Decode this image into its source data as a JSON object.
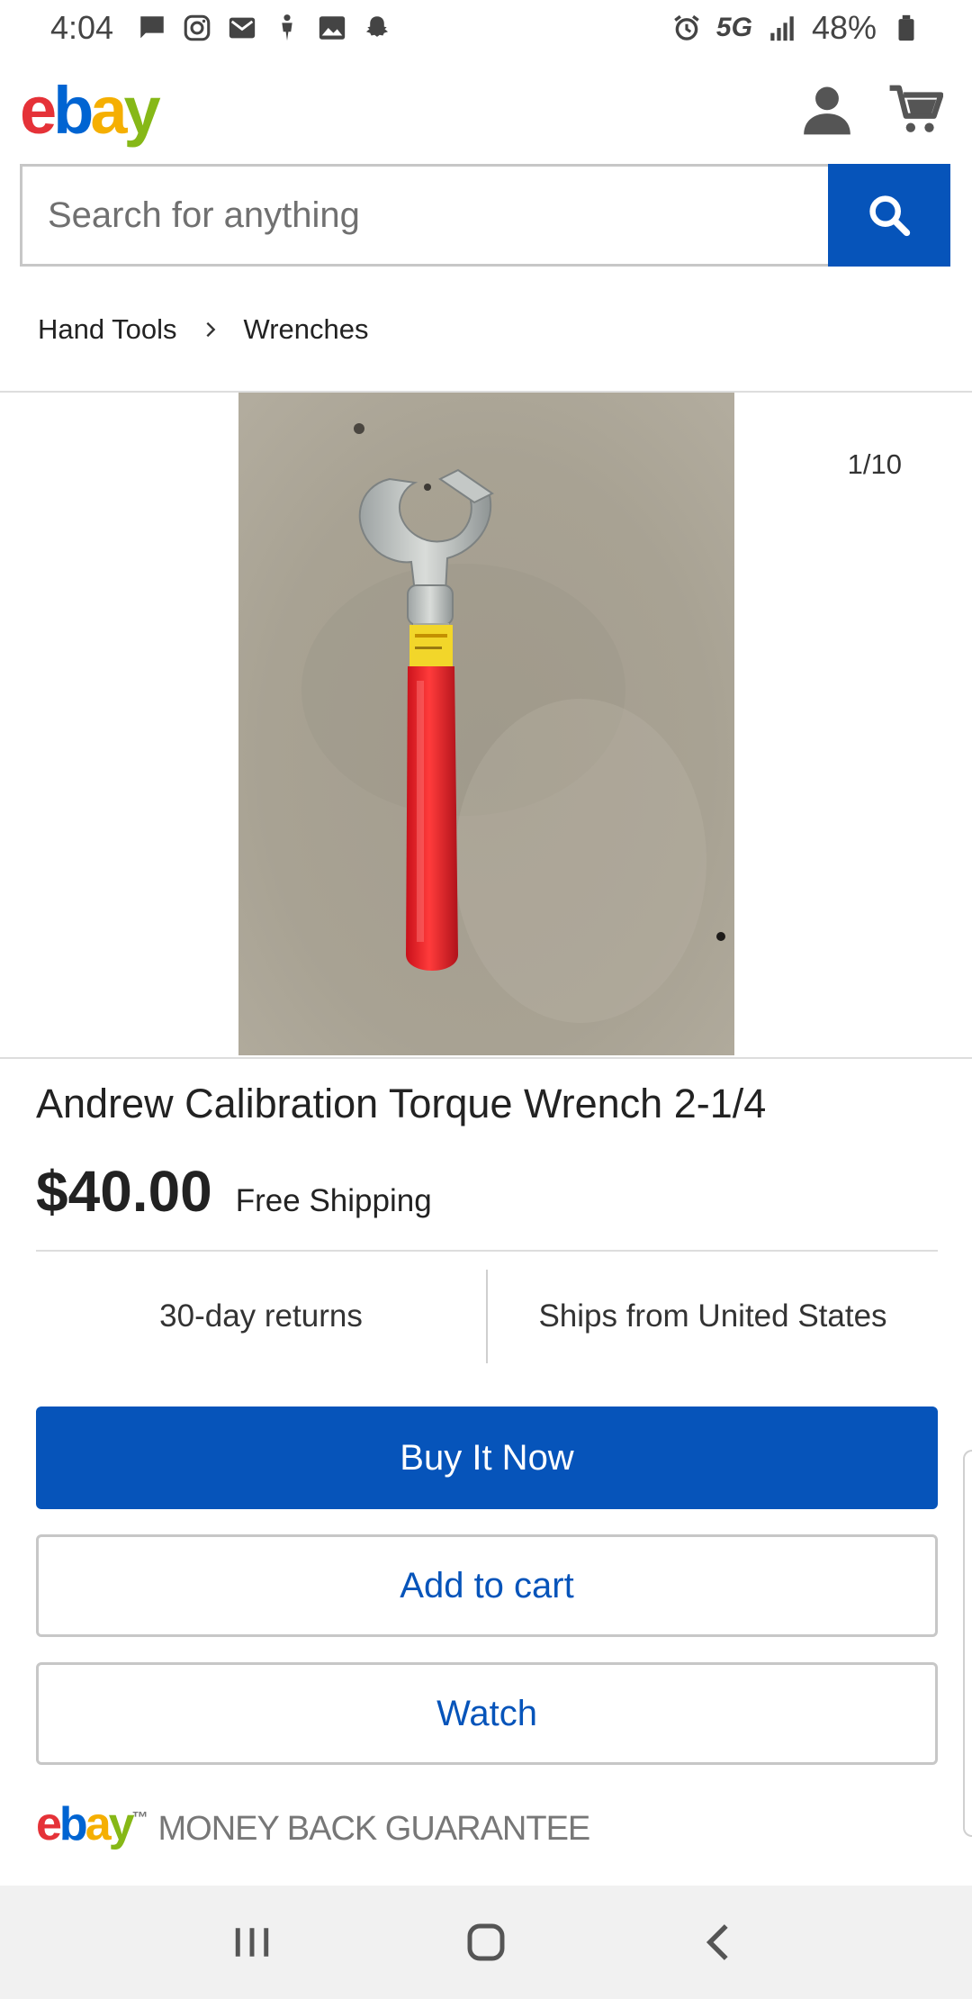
{
  "status_bar": {
    "time": "4:04",
    "network": "5G",
    "battery": "48%",
    "left_icons": [
      "message-icon",
      "instagram-icon",
      "mail-icon",
      "figure-icon",
      "image-icon",
      "snapchat-icon"
    ],
    "right_icons": [
      "alarm-icon",
      "signal-icon",
      "battery-icon"
    ]
  },
  "header": {
    "logo": {
      "e": "e",
      "b": "b",
      "a": "a",
      "y": "y"
    },
    "icons": [
      "account-icon",
      "cart-icon"
    ]
  },
  "search": {
    "placeholder": "Search for anything",
    "button_icon": "search-icon"
  },
  "breadcrumb": {
    "items": [
      "Hand Tools",
      "Wrenches"
    ]
  },
  "gallery": {
    "counter": "1/10"
  },
  "product": {
    "title": "Andrew Calibration Torque Wrench 2-1/4",
    "price": "$40.00",
    "shipping": "Free Shipping",
    "features": [
      "30-day returns",
      "Ships from United States"
    ]
  },
  "actions": {
    "buy_now": "Buy It Now",
    "add_to_cart": "Add to cart",
    "watch": "Watch"
  },
  "guarantee": {
    "text": "MONEY BACK GUARANTEE",
    "tm": "™"
  },
  "colors": {
    "primary_blue": "#0654ba",
    "ebay_red": "#e53238",
    "ebay_blue": "#0064d2",
    "ebay_yellow": "#f5af02",
    "ebay_green": "#86b817"
  },
  "navbar": {
    "buttons": [
      "recents-icon",
      "home-icon",
      "back-icon"
    ]
  }
}
